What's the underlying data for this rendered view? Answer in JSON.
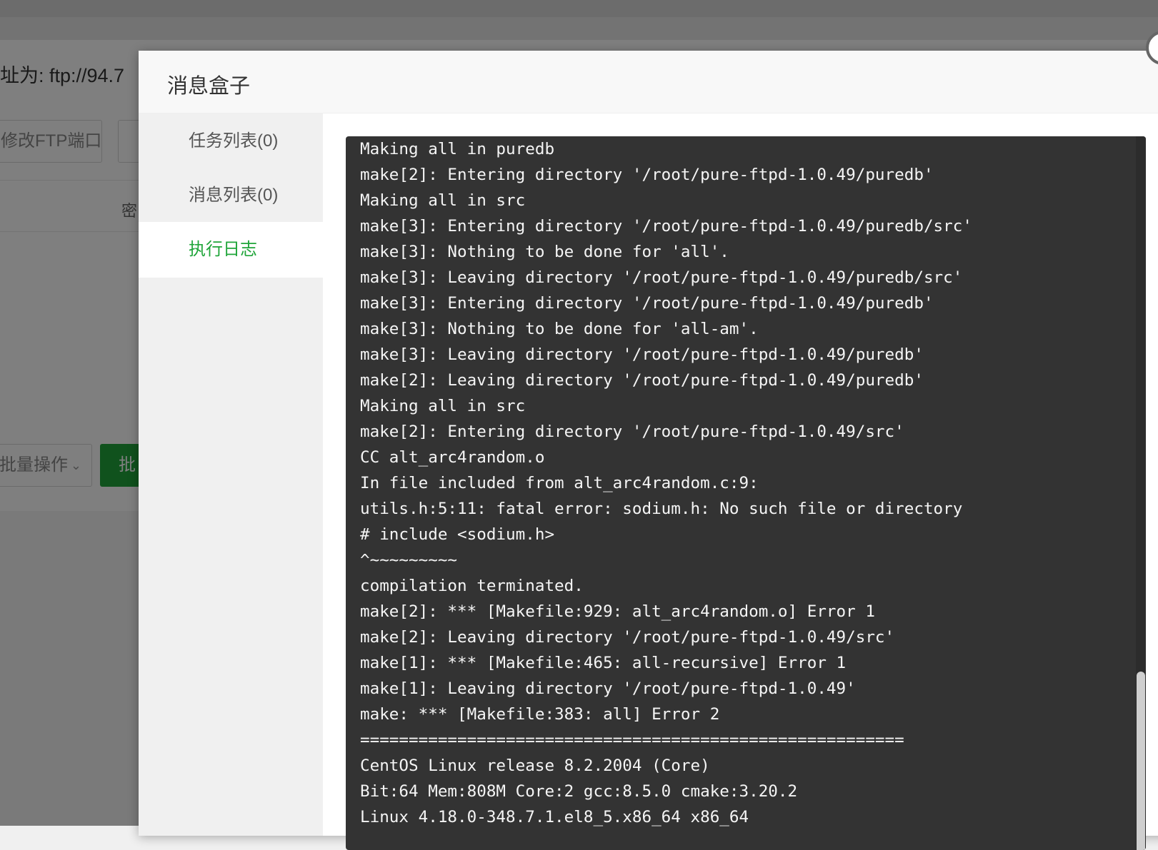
{
  "background": {
    "address_text": "址为:  ftp://94.7",
    "port_button_label": "修改FTP端口",
    "column_password": "密",
    "batch_select_label": "批量操作",
    "batch_button_label": "批"
  },
  "dialog": {
    "title": "消息盒子",
    "sidebar": {
      "items": [
        {
          "label": "任务列表(0)",
          "active": false
        },
        {
          "label": "消息列表(0)",
          "active": false
        },
        {
          "label": "执行日志",
          "active": true
        }
      ]
    },
    "log": {
      "lines": [
        "Making all in puredb",
        "make[2]: Entering directory '/root/pure-ftpd-1.0.49/puredb'",
        "Making all in src",
        "make[3]: Entering directory '/root/pure-ftpd-1.0.49/puredb/src'",
        "make[3]: Nothing to be done for 'all'.",
        "make[3]: Leaving directory '/root/pure-ftpd-1.0.49/puredb/src'",
        "make[3]: Entering directory '/root/pure-ftpd-1.0.49/puredb'",
        "make[3]: Nothing to be done for 'all-am'.",
        "make[3]: Leaving directory '/root/pure-ftpd-1.0.49/puredb'",
        "make[2]: Leaving directory '/root/pure-ftpd-1.0.49/puredb'",
        "Making all in src",
        "make[2]: Entering directory '/root/pure-ftpd-1.0.49/src'",
        "CC alt_arc4random.o",
        "In file included from alt_arc4random.c:9:",
        "utils.h:5:11: fatal error: sodium.h: No such file or directory",
        "# include <sodium.h>",
        "^~~~~~~~~~",
        "compilation terminated.",
        "make[2]: *** [Makefile:929: alt_arc4random.o] Error 1",
        "make[2]: Leaving directory '/root/pure-ftpd-1.0.49/src'",
        "make[1]: *** [Makefile:465: all-recursive] Error 1",
        "make[1]: Leaving directory '/root/pure-ftpd-1.0.49'",
        "make: *** [Makefile:383: all] Error 2",
        "========================================================",
        "CentOS Linux release 8.2.2004 (Core)",
        "Bit:64 Mem:808M Core:2 gcc:8.5.0 cmake:3.20.2",
        "Linux 4.18.0-348.7.1.el8_5.x86_64 x86_64"
      ]
    }
  },
  "colors": {
    "accent": "#20a53a",
    "log_background": "#333333",
    "log_text": "#f5f5f5"
  }
}
